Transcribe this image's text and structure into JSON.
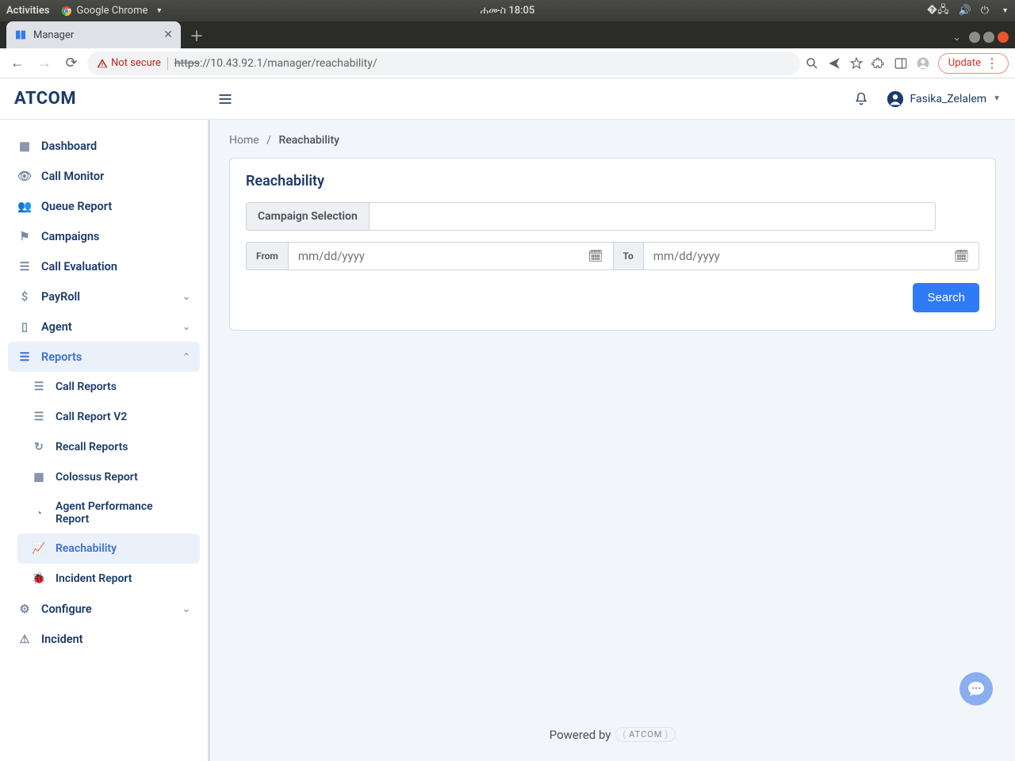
{
  "os": {
    "activities": "Activities",
    "chrome": "Google Chrome",
    "clock": "ሐሙስ 18:05"
  },
  "tab": {
    "title": "Manager"
  },
  "url": {
    "insecure_label": "Not secure",
    "scheme": "https",
    "rest": "://10.43.92.1/manager/reachability/",
    "update": "Update"
  },
  "header": {
    "brand": "ATCOM",
    "user": "Fasika_Zelalem"
  },
  "sidebar": {
    "dashboard": "Dashboard",
    "call_monitor": "Call Monitor",
    "queue_report": "Queue Report",
    "campaigns": "Campaigns",
    "call_evaluation": "Call Evaluation",
    "payroll": "PayRoll",
    "agent": "Agent",
    "reports": "Reports",
    "call_reports": "Call Reports",
    "call_report_v2": "Call Report V2",
    "recall_reports": "Recall Reports",
    "colossus_report": "Colossus Report",
    "agent_perf": "Agent Performance Report",
    "reachability": "Reachability",
    "incident_report": "Incident Report",
    "configure": "Configure",
    "incident": "Incident"
  },
  "breadcrumb": {
    "home": "Home",
    "current": "Reachability"
  },
  "card": {
    "title": "Reachability",
    "campaign_label": "Campaign Selection",
    "campaign_value": "",
    "from_label": "From",
    "from_placeholder": "mm/dd/yyyy",
    "to_label": "To",
    "to_placeholder": "mm/dd/yyyy",
    "search": "Search"
  },
  "footer": {
    "powered": "Powered by",
    "brand": "ATCOM"
  }
}
